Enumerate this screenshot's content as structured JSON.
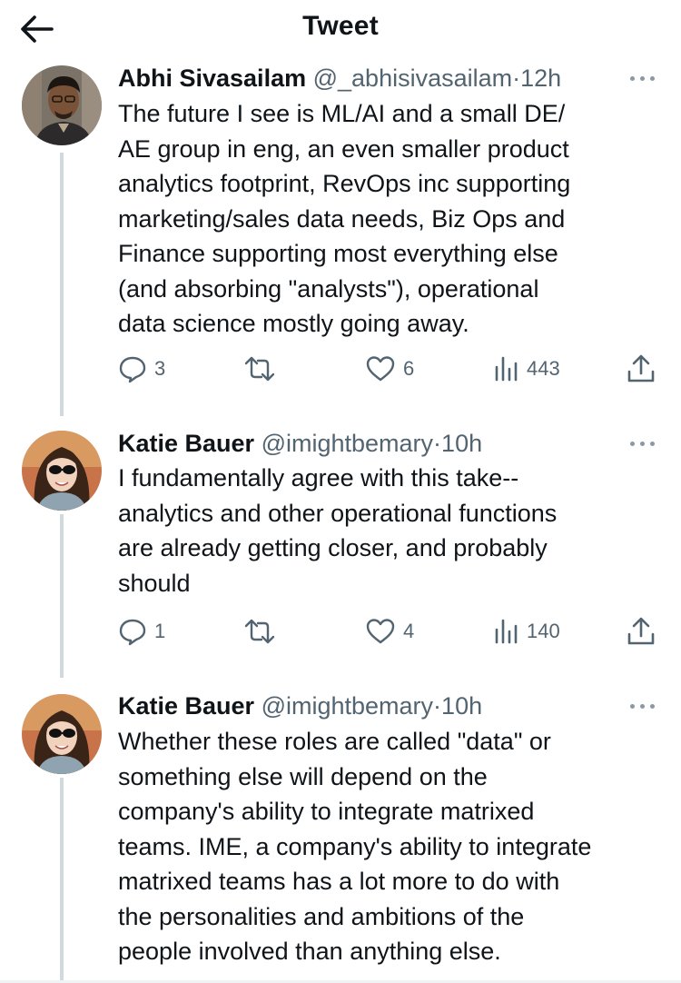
{
  "header": {
    "title": "Tweet"
  },
  "tweets": [
    {
      "name": "Abhi Sivasailam",
      "handle": "@_abhisivasailam",
      "separator": "·",
      "time": "12h",
      "lines": [
        "The future I see is ML/AI and a small DE/",
        "AE group in eng, an even smaller product",
        "analytics footprint, RevOps inc supporting",
        "marketing/sales data needs, Biz Ops and",
        "Finance supporting most everything else",
        "(and absorbing \"analysts\"), operational",
        "data science mostly going away."
      ],
      "replies": "3",
      "retweets": "",
      "likes": "6",
      "views": "443"
    },
    {
      "name": "Katie Bauer",
      "handle": "@imightbemary",
      "separator": "·",
      "time": "10h",
      "lines": [
        "I fundamentally agree with this take--",
        "analytics and other operational functions",
        "are already getting closer, and probably",
        "should"
      ],
      "replies": "1",
      "retweets": "",
      "likes": "4",
      "views": "140"
    },
    {
      "name": "Katie Bauer",
      "handle": "@imightbemary",
      "separator": "·",
      "time": "10h",
      "lines": [
        "Whether these roles are called \"data\" or",
        "something else will depend on the",
        "company's ability to integrate matrixed",
        "teams. IME, a company's ability to integrate",
        "matrixed teams has a lot more to do with",
        "the personalities and ambitions of the",
        "people involved than anything else."
      ]
    }
  ],
  "icons": {
    "back": "arrow-left-icon",
    "more": "more-dots-icon",
    "reply": "reply-bubble-icon",
    "retweet": "retweet-icon",
    "like": "heart-icon",
    "views": "views-bars-icon",
    "share": "share-upload-icon"
  },
  "colors": {
    "text": "#0f1419",
    "secondary": "#536471",
    "thread_line": "#cfd9de"
  }
}
